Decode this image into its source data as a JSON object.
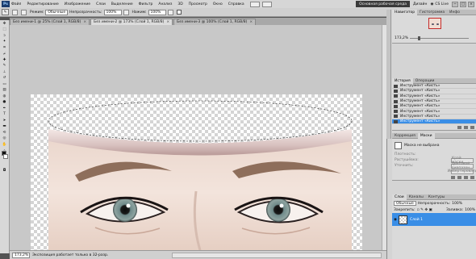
{
  "menubar": {
    "logo": "Ps",
    "items": [
      "Файл",
      "Редактирование",
      "Изображение",
      "Слои",
      "Выделение",
      "Фильтр",
      "Анализ",
      "3D",
      "Просмотр",
      "Окно",
      "Справка"
    ],
    "workspace": "Основная рабочая среда",
    "design": "Дизайн",
    "cslive": "CS Live",
    "win_minimize": "−",
    "win_restore": "□",
    "win_close": "×"
  },
  "options": {
    "style_label": "Режим:",
    "style_value": "Обычные",
    "opacity_label": "Непрозрачность:",
    "opacity_value": "100%",
    "flow_label": "Нажим:",
    "flow_value": "100%"
  },
  "tabs": [
    {
      "label": "Без имени-1 @ 25% (Слой 1, RGB/8)",
      "close": "×"
    },
    {
      "label": "Без имени-2 @ 173% (Слой 1, RGB/8)",
      "close": "×"
    },
    {
      "label": "Без имени-3 @ 100% (Слой 1, RGB/8)",
      "close": "×"
    }
  ],
  "status": {
    "zoom": "173,2%",
    "info": "Экспозиция работает только в 32-разр."
  },
  "navigator": {
    "tabs": [
      "Навигатор",
      "Гистограмма",
      "Инфо"
    ],
    "zoom": "173,2%"
  },
  "history": {
    "tabs": [
      "История",
      "Операции"
    ],
    "rows": [
      "Инструмент «Кисть»",
      "Инструмент «Кисть»",
      "Инструмент «Кисть»",
      "Инструмент «Кисть»",
      "Инструмент «Кисть»",
      "Инструмент «Кисть»",
      "Инструмент «Кисть»",
      "Инструмент «Кисть»"
    ],
    "selected_index": 7
  },
  "masks": {
    "tabs": [
      "Коррекция",
      "Маски"
    ],
    "title": "Маска не выбрана",
    "rows": [
      "Плотность:",
      "Растушёвка:",
      "Уточнить:"
    ],
    "buttons": [
      "Край маски...",
      "Цветовой диапазон...",
      "Инвертировать"
    ]
  },
  "layers": {
    "tabs": [
      "Слои",
      "Каналы",
      "Контуры"
    ],
    "blend": "Обычные",
    "opacity_label": "Непрозрачность:",
    "opacity_value": "100%",
    "lock_label": "Закрепить:",
    "fill_label": "Заливка:",
    "fill_value": "100%",
    "layer_name": "Слой 1"
  },
  "colors": {
    "selection": "#3a8ee6",
    "workspace_bg": "#c8c8c8"
  }
}
